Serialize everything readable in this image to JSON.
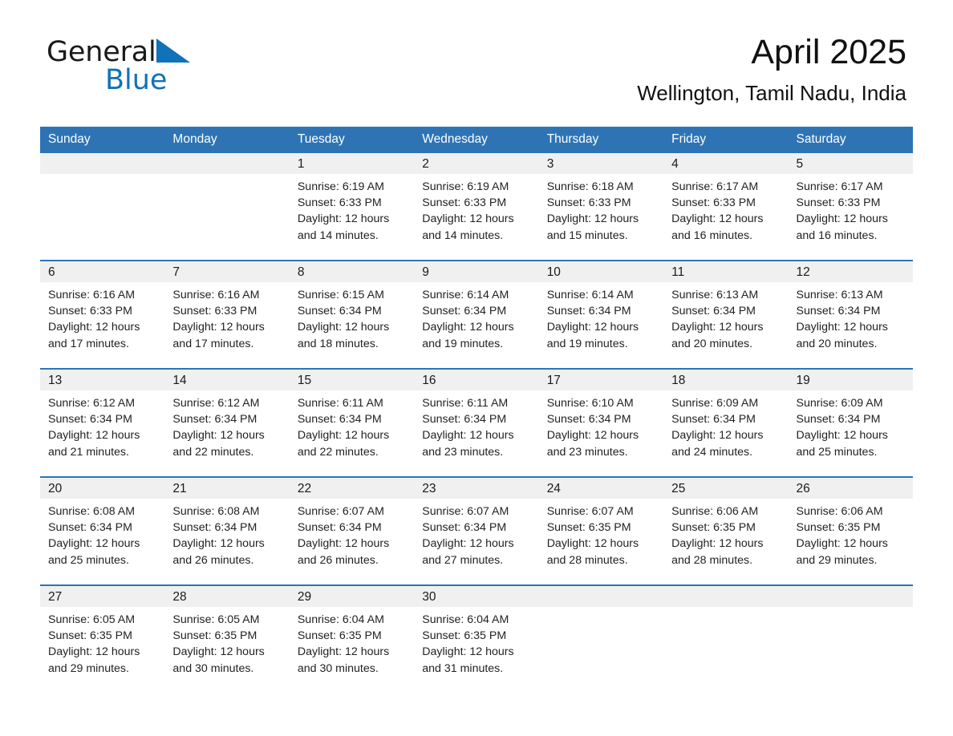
{
  "brand": {
    "name_top": "General",
    "name_bottom": "Blue",
    "triangle_color": "#1072b8"
  },
  "header": {
    "title": "April 2025",
    "subtitle": "Wellington, Tamil Nadu, India"
  },
  "theme": {
    "header_bg": "#2e74b5",
    "header_text": "#ffffff",
    "date_band_bg": "#f0f0f0",
    "row_separator": "#2e74b5"
  },
  "weekday_headers": [
    "Sunday",
    "Monday",
    "Tuesday",
    "Wednesday",
    "Thursday",
    "Friday",
    "Saturday"
  ],
  "weeks": [
    [
      {
        "empty": true
      },
      {
        "empty": true
      },
      {
        "day": "1",
        "sunrise": "Sunrise: 6:19 AM",
        "sunset": "Sunset: 6:33 PM",
        "daylight_1": "Daylight: 12 hours",
        "daylight_2": "and 14 minutes."
      },
      {
        "day": "2",
        "sunrise": "Sunrise: 6:19 AM",
        "sunset": "Sunset: 6:33 PM",
        "daylight_1": "Daylight: 12 hours",
        "daylight_2": "and 14 minutes."
      },
      {
        "day": "3",
        "sunrise": "Sunrise: 6:18 AM",
        "sunset": "Sunset: 6:33 PM",
        "daylight_1": "Daylight: 12 hours",
        "daylight_2": "and 15 minutes."
      },
      {
        "day": "4",
        "sunrise": "Sunrise: 6:17 AM",
        "sunset": "Sunset: 6:33 PM",
        "daylight_1": "Daylight: 12 hours",
        "daylight_2": "and 16 minutes."
      },
      {
        "day": "5",
        "sunrise": "Sunrise: 6:17 AM",
        "sunset": "Sunset: 6:33 PM",
        "daylight_1": "Daylight: 12 hours",
        "daylight_2": "and 16 minutes."
      }
    ],
    [
      {
        "day": "6",
        "sunrise": "Sunrise: 6:16 AM",
        "sunset": "Sunset: 6:33 PM",
        "daylight_1": "Daylight: 12 hours",
        "daylight_2": "and 17 minutes."
      },
      {
        "day": "7",
        "sunrise": "Sunrise: 6:16 AM",
        "sunset": "Sunset: 6:33 PM",
        "daylight_1": "Daylight: 12 hours",
        "daylight_2": "and 17 minutes."
      },
      {
        "day": "8",
        "sunrise": "Sunrise: 6:15 AM",
        "sunset": "Sunset: 6:34 PM",
        "daylight_1": "Daylight: 12 hours",
        "daylight_2": "and 18 minutes."
      },
      {
        "day": "9",
        "sunrise": "Sunrise: 6:14 AM",
        "sunset": "Sunset: 6:34 PM",
        "daylight_1": "Daylight: 12 hours",
        "daylight_2": "and 19 minutes."
      },
      {
        "day": "10",
        "sunrise": "Sunrise: 6:14 AM",
        "sunset": "Sunset: 6:34 PM",
        "daylight_1": "Daylight: 12 hours",
        "daylight_2": "and 19 minutes."
      },
      {
        "day": "11",
        "sunrise": "Sunrise: 6:13 AM",
        "sunset": "Sunset: 6:34 PM",
        "daylight_1": "Daylight: 12 hours",
        "daylight_2": "and 20 minutes."
      },
      {
        "day": "12",
        "sunrise": "Sunrise: 6:13 AM",
        "sunset": "Sunset: 6:34 PM",
        "daylight_1": "Daylight: 12 hours",
        "daylight_2": "and 20 minutes."
      }
    ],
    [
      {
        "day": "13",
        "sunrise": "Sunrise: 6:12 AM",
        "sunset": "Sunset: 6:34 PM",
        "daylight_1": "Daylight: 12 hours",
        "daylight_2": "and 21 minutes."
      },
      {
        "day": "14",
        "sunrise": "Sunrise: 6:12 AM",
        "sunset": "Sunset: 6:34 PM",
        "daylight_1": "Daylight: 12 hours",
        "daylight_2": "and 22 minutes."
      },
      {
        "day": "15",
        "sunrise": "Sunrise: 6:11 AM",
        "sunset": "Sunset: 6:34 PM",
        "daylight_1": "Daylight: 12 hours",
        "daylight_2": "and 22 minutes."
      },
      {
        "day": "16",
        "sunrise": "Sunrise: 6:11 AM",
        "sunset": "Sunset: 6:34 PM",
        "daylight_1": "Daylight: 12 hours",
        "daylight_2": "and 23 minutes."
      },
      {
        "day": "17",
        "sunrise": "Sunrise: 6:10 AM",
        "sunset": "Sunset: 6:34 PM",
        "daylight_1": "Daylight: 12 hours",
        "daylight_2": "and 23 minutes."
      },
      {
        "day": "18",
        "sunrise": "Sunrise: 6:09 AM",
        "sunset": "Sunset: 6:34 PM",
        "daylight_1": "Daylight: 12 hours",
        "daylight_2": "and 24 minutes."
      },
      {
        "day": "19",
        "sunrise": "Sunrise: 6:09 AM",
        "sunset": "Sunset: 6:34 PM",
        "daylight_1": "Daylight: 12 hours",
        "daylight_2": "and 25 minutes."
      }
    ],
    [
      {
        "day": "20",
        "sunrise": "Sunrise: 6:08 AM",
        "sunset": "Sunset: 6:34 PM",
        "daylight_1": "Daylight: 12 hours",
        "daylight_2": "and 25 minutes."
      },
      {
        "day": "21",
        "sunrise": "Sunrise: 6:08 AM",
        "sunset": "Sunset: 6:34 PM",
        "daylight_1": "Daylight: 12 hours",
        "daylight_2": "and 26 minutes."
      },
      {
        "day": "22",
        "sunrise": "Sunrise: 6:07 AM",
        "sunset": "Sunset: 6:34 PM",
        "daylight_1": "Daylight: 12 hours",
        "daylight_2": "and 26 minutes."
      },
      {
        "day": "23",
        "sunrise": "Sunrise: 6:07 AM",
        "sunset": "Sunset: 6:34 PM",
        "daylight_1": "Daylight: 12 hours",
        "daylight_2": "and 27 minutes."
      },
      {
        "day": "24",
        "sunrise": "Sunrise: 6:07 AM",
        "sunset": "Sunset: 6:35 PM",
        "daylight_1": "Daylight: 12 hours",
        "daylight_2": "and 28 minutes."
      },
      {
        "day": "25",
        "sunrise": "Sunrise: 6:06 AM",
        "sunset": "Sunset: 6:35 PM",
        "daylight_1": "Daylight: 12 hours",
        "daylight_2": "and 28 minutes."
      },
      {
        "day": "26",
        "sunrise": "Sunrise: 6:06 AM",
        "sunset": "Sunset: 6:35 PM",
        "daylight_1": "Daylight: 12 hours",
        "daylight_2": "and 29 minutes."
      }
    ],
    [
      {
        "day": "27",
        "sunrise": "Sunrise: 6:05 AM",
        "sunset": "Sunset: 6:35 PM",
        "daylight_1": "Daylight: 12 hours",
        "daylight_2": "and 29 minutes."
      },
      {
        "day": "28",
        "sunrise": "Sunrise: 6:05 AM",
        "sunset": "Sunset: 6:35 PM",
        "daylight_1": "Daylight: 12 hours",
        "daylight_2": "and 30 minutes."
      },
      {
        "day": "29",
        "sunrise": "Sunrise: 6:04 AM",
        "sunset": "Sunset: 6:35 PM",
        "daylight_1": "Daylight: 12 hours",
        "daylight_2": "and 30 minutes."
      },
      {
        "day": "30",
        "sunrise": "Sunrise: 6:04 AM",
        "sunset": "Sunset: 6:35 PM",
        "daylight_1": "Daylight: 12 hours",
        "daylight_2": "and 31 minutes."
      },
      {
        "empty": true
      },
      {
        "empty": true
      },
      {
        "empty": true
      }
    ]
  ]
}
